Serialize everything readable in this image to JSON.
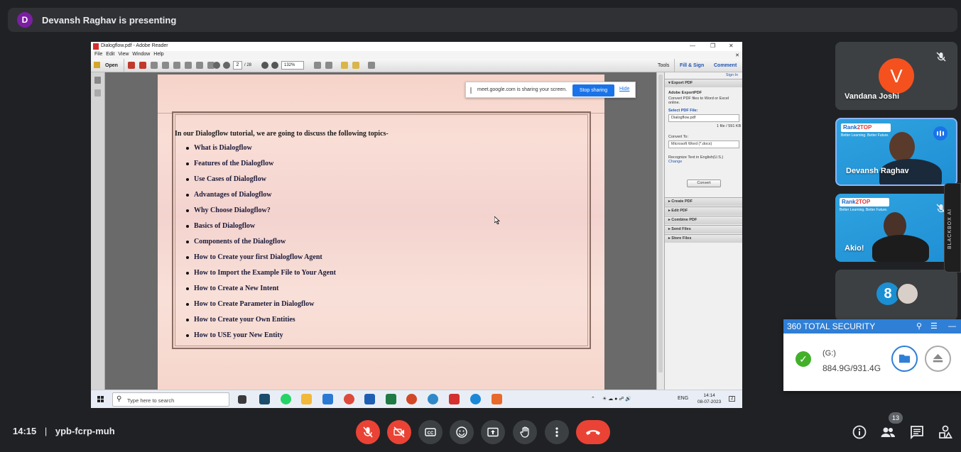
{
  "banner": {
    "initial": "D",
    "text": "Devansh Raghav is presenting"
  },
  "reader": {
    "window_title": "Dialogflow.pdf - Adobe Reader",
    "menu": [
      "File",
      "Edit",
      "View",
      "Window",
      "Help"
    ],
    "toolbar": {
      "open": "Open",
      "page": "2",
      "page_total": "/ 28",
      "zoom": "132%",
      "tools": "Tools",
      "fill_sign": "Fill & Sign",
      "comment": "Comment"
    },
    "document": {
      "heading": "In our Dialogflow tutorial, we are going to discuss the following topics-",
      "topics": [
        "What is Dialogflow",
        "Features of the Dialogflow",
        "Use Cases of Dialogflow",
        "Advantages of Dialogflow",
        "Why Choose Dialogflow?",
        "Basics of Dialogflow",
        "Components of the Dialogflow",
        "How to Create your first Dialogflow Agent",
        "How to Import the Example File to Your Agent",
        "How to Create a New Intent",
        "How to Create Parameter in Dialogflow",
        "How to Create your Own Entities",
        "How to USE your New Entity"
      ]
    },
    "panel": {
      "sign_in": "Sign In",
      "export_header": "Export PDF",
      "export_title": "Adobe ExportPDF",
      "export_desc": "Convert PDF files to Word or Excel online.",
      "select_label": "Select PDF File:",
      "file_name": "Dialogflow.pdf",
      "file_count": "1 file / 591 KB",
      "convert_to_label": "Convert To:",
      "convert_to_value": "Microsoft Word (*.docx)",
      "recognize": "Recognize Text in English(U.S.)",
      "change": "Change",
      "convert_btn": "Convert",
      "sections": [
        "Create PDF",
        "Edit PDF",
        "Combine PDF",
        "Send Files",
        "Store Files"
      ]
    },
    "taskbar": {
      "search_placeholder": "Type here to search",
      "lang": "ENG",
      "time": "14:14",
      "date": "08-07-2023",
      "notif": "2"
    }
  },
  "share_bar": {
    "message": "meet.google.com is sharing your screen.",
    "stop": "Stop sharing",
    "hide": "Hide"
  },
  "participants": [
    {
      "name": "Vandana Joshi",
      "initial": "V"
    },
    {
      "name": "Devansh Raghav"
    },
    {
      "name": "Akio!"
    }
  ],
  "brand": {
    "logo_a": "Rank",
    "logo_b": "2TOP",
    "tagline": "Better Learning. Better Future."
  },
  "blackbox": "BLACKBOX AI",
  "security": {
    "title": "360 TOTAL SECURITY",
    "drive": "(G:)",
    "size": "884.9G/931.4G"
  },
  "meeting": {
    "time": "14:15",
    "separator": "|",
    "code": "ypb-fcrp-muh",
    "participant_count": "13"
  },
  "colors": {
    "meet_bg": "#202124",
    "danger": "#ea4335",
    "accent": "#1a73e8",
    "security_blue": "#2f7fd6"
  }
}
